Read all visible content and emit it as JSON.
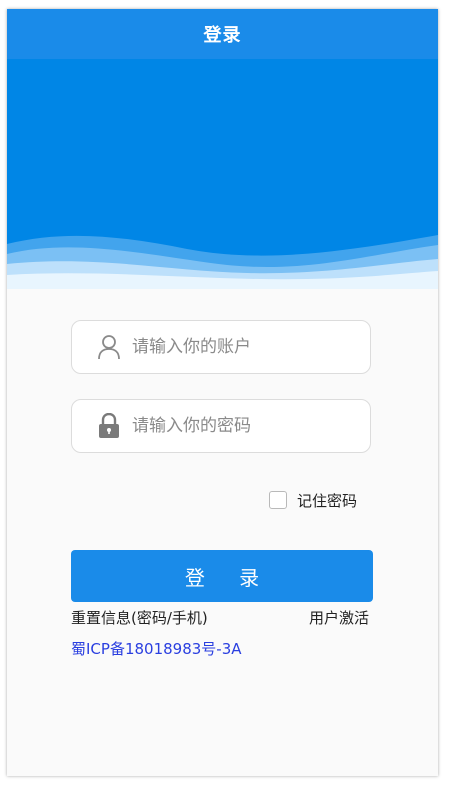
{
  "header": {
    "title": "登录",
    "background": "#1a8be9"
  },
  "banner": {
    "background": "#0086e6"
  },
  "form": {
    "account": {
      "placeholder": "请输入你的账户",
      "value": "",
      "icon": "user-icon"
    },
    "password": {
      "placeholder": "请输入你的密码",
      "value": "",
      "icon": "lock-icon"
    },
    "remember_label": "记住密码",
    "remember_checked": false,
    "login_label": "登 录"
  },
  "links": {
    "reset": "重置信息(密码/手机)",
    "activate": "用户激活"
  },
  "footer": {
    "icp": "蜀ICP备18018983号-3A"
  }
}
